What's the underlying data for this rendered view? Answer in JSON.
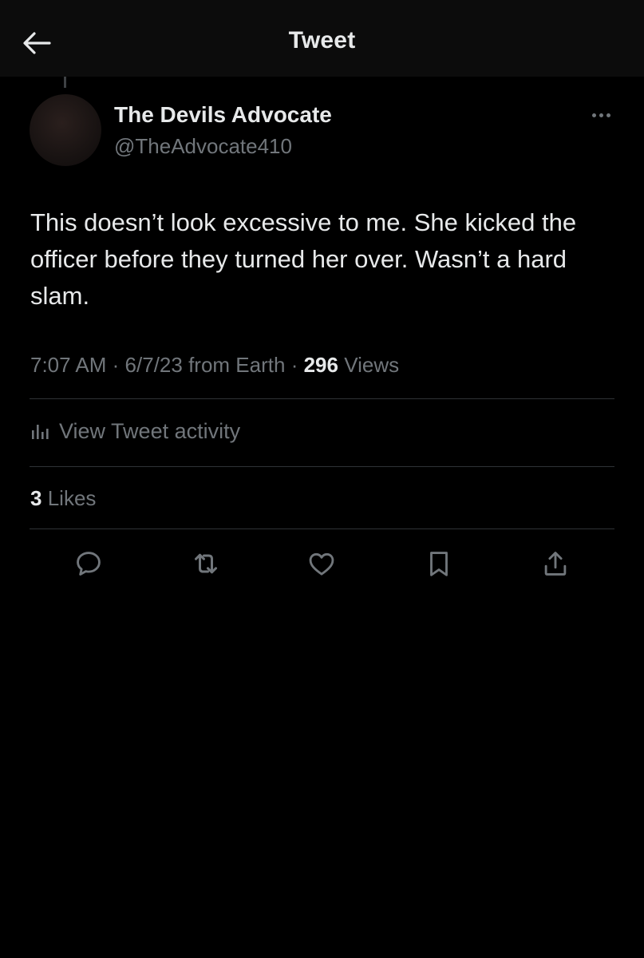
{
  "header": {
    "title": "Tweet",
    "back_icon": "arrow-left-icon"
  },
  "tweet": {
    "author_name": "The Devils Advocate",
    "author_handle": "@TheAdvocate410",
    "text": "This doesn’t look excessive to me. She kicked the officer before they turned her over. Wasn’t a hard slam.",
    "time": "7:07 AM",
    "date": "6/7/23",
    "source": "from Earth",
    "views_count": "296",
    "views_label": "Views",
    "separator": "·"
  },
  "activity": {
    "label": "View Tweet activity",
    "icon": "bar-chart-icon"
  },
  "likes": {
    "count": "3",
    "label": "Likes"
  },
  "actions": [
    {
      "name": "reply",
      "icon": "reply-icon"
    },
    {
      "name": "retweet",
      "icon": "retweet-icon"
    },
    {
      "name": "like",
      "icon": "heart-icon"
    },
    {
      "name": "bookmark",
      "icon": "bookmark-icon"
    },
    {
      "name": "share",
      "icon": "share-icon"
    }
  ],
  "colors": {
    "background": "#000000",
    "header_background": "#0c0c0c",
    "primary_text": "#e7e9ea",
    "secondary_text": "#71767b",
    "divider": "#2f3336"
  }
}
